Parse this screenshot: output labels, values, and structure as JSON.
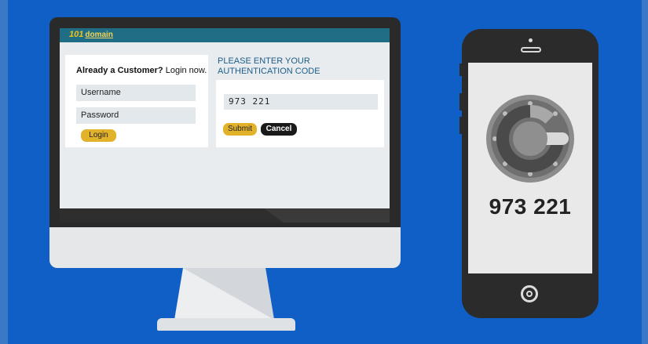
{
  "site": {
    "logo_number": "101",
    "logo_word": "domain"
  },
  "login_panel": {
    "heading_bold": "Already a Customer?",
    "heading_rest": " Login now.",
    "username_placeholder": "Username",
    "password_placeholder": "Password",
    "login_label": "Login"
  },
  "auth_panel": {
    "heading": "PLEASE ENTER YOUR AUTHENTICATION CODE",
    "code_value": "973 221",
    "submit_label": "Submit",
    "cancel_label": "Cancel"
  },
  "phone": {
    "app_icon": "google-authenticator-icon",
    "code": "973 221"
  },
  "colors": {
    "background": "#0f5fc6",
    "topbar": "#1f6e85",
    "accent_button": "#e2b22b",
    "dark_button": "#1a1a1a",
    "heading_blue": "#1d5d88"
  }
}
